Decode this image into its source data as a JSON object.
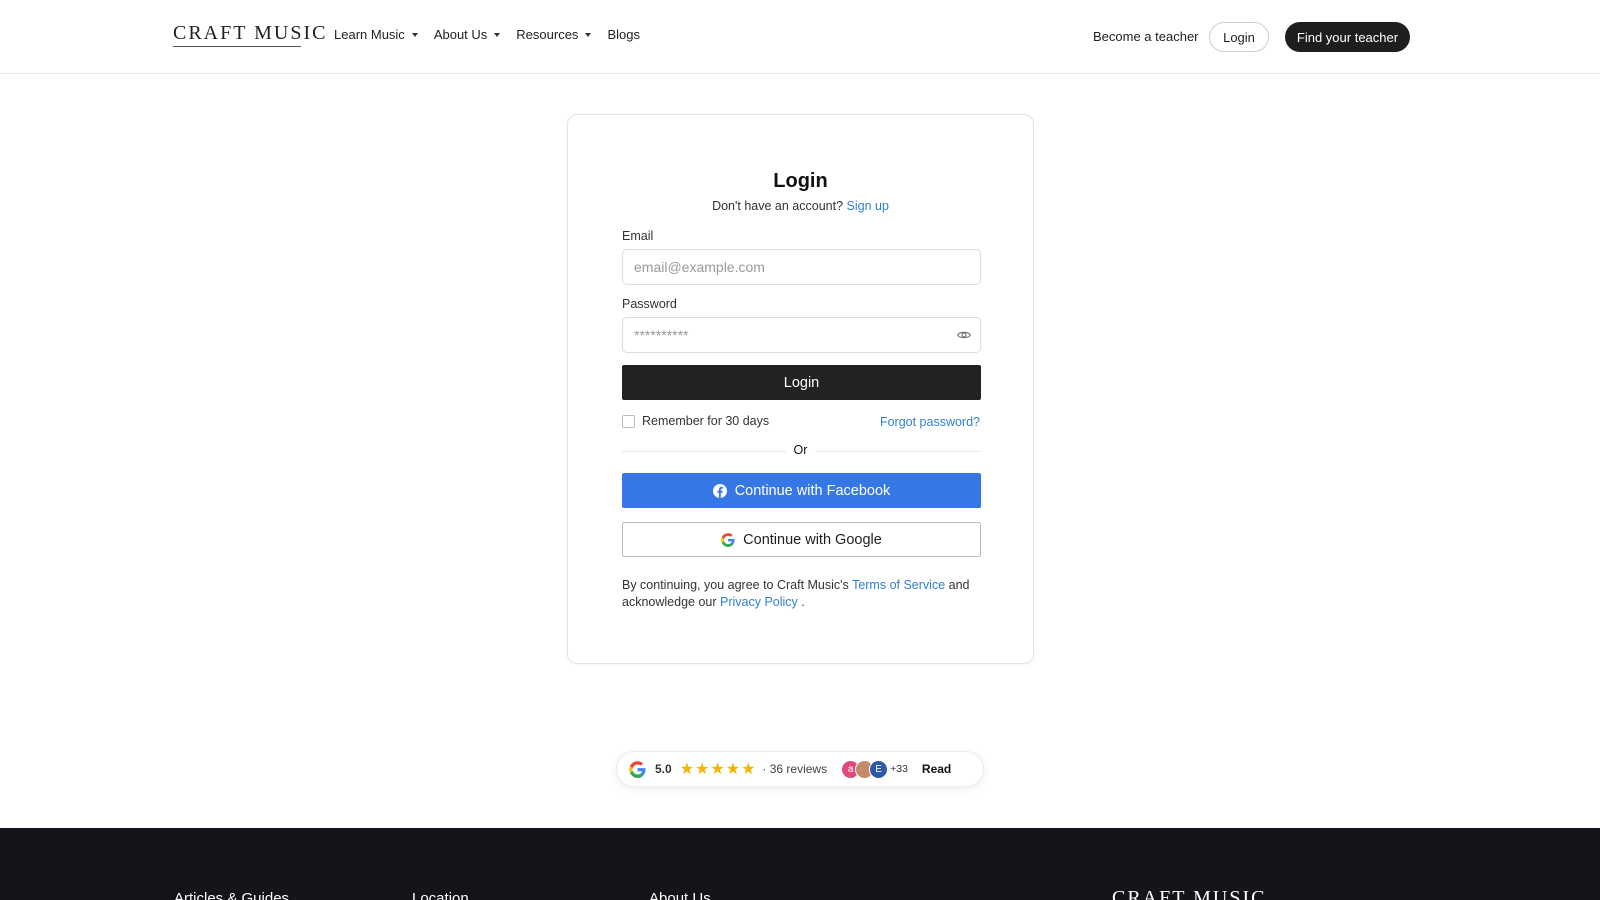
{
  "header": {
    "logo": "CRAFT MUSIC",
    "nav": [
      {
        "label": "Learn Music",
        "dropdown": true
      },
      {
        "label": "About Us",
        "dropdown": true
      },
      {
        "label": "Resources",
        "dropdown": true
      },
      {
        "label": "Blogs",
        "dropdown": false
      }
    ],
    "become_teacher": "Become a teacher",
    "login": "Login",
    "find_teacher": "Find your teacher"
  },
  "card": {
    "title": "Login",
    "no_account": "Don't have an account?",
    "sign_up": "Sign up",
    "email_label": "Email",
    "email_placeholder": "email@example.com",
    "password_label": "Password",
    "password_placeholder": "**********",
    "login_button": "Login",
    "remember": "Remember for 30 days",
    "forgot": "Forgot password?",
    "or": "Or",
    "facebook": "Continue with Facebook",
    "google": "Continue with Google",
    "legal_prefix": "By continuing, you agree to Craft Music's",
    "terms": "Terms of Service",
    "legal_mid": "and acknowledge our",
    "privacy": "Privacy Policy",
    "legal_suffix": "."
  },
  "reviews": {
    "rating": "5.0",
    "stars": "★★★★★",
    "count": "· 36 reviews",
    "avatars": [
      {
        "initial": "a",
        "color": "#e0497a"
      },
      {
        "initial": "",
        "color": "#c48a6a"
      },
      {
        "initial": "E",
        "color": "#2d5aa8"
      }
    ],
    "more": "+33",
    "read": "Read"
  },
  "footer": {
    "columns": [
      "Articles & Guides",
      "Location",
      "About Us"
    ],
    "logo": "CRAFT MUSIC"
  },
  "colors": {
    "accent_link": "#2f7fd6",
    "facebook": "#3578e5",
    "dark": "#222222",
    "footer_bg": "#14141b",
    "star": "#f4b400"
  }
}
